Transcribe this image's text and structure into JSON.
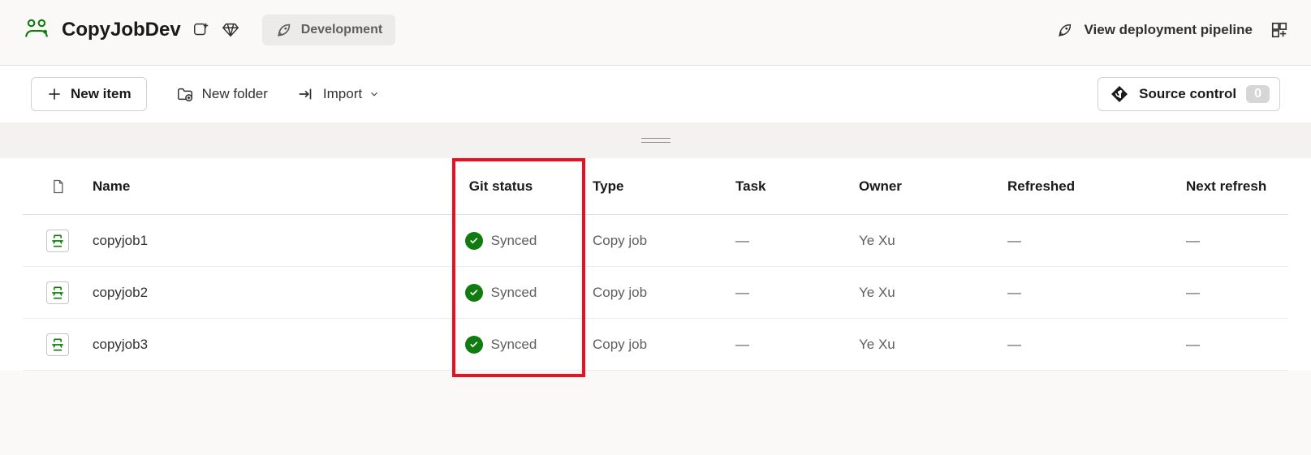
{
  "header": {
    "workspace_title": "CopyJobDev",
    "environment_label": "Development",
    "view_pipeline_label": "View deployment pipeline"
  },
  "toolbar": {
    "new_item_label": "New item",
    "new_folder_label": "New folder",
    "import_label": "Import",
    "source_control_label": "Source control",
    "source_control_count": "0"
  },
  "table": {
    "columns": {
      "name": "Name",
      "git_status": "Git status",
      "type": "Type",
      "task": "Task",
      "owner": "Owner",
      "refreshed": "Refreshed",
      "next_refresh": "Next refresh"
    },
    "rows": [
      {
        "name": "copyjob1",
        "git_status": "Synced",
        "type": "Copy job",
        "task": "—",
        "owner": "Ye Xu",
        "refreshed": "—",
        "next_refresh": "—"
      },
      {
        "name": "copyjob2",
        "git_status": "Synced",
        "type": "Copy job",
        "task": "—",
        "owner": "Ye Xu",
        "refreshed": "—",
        "next_refresh": "—"
      },
      {
        "name": "copyjob3",
        "git_status": "Synced",
        "type": "Copy job",
        "task": "—",
        "owner": "Ye Xu",
        "refreshed": "—",
        "next_refresh": "—"
      }
    ]
  }
}
